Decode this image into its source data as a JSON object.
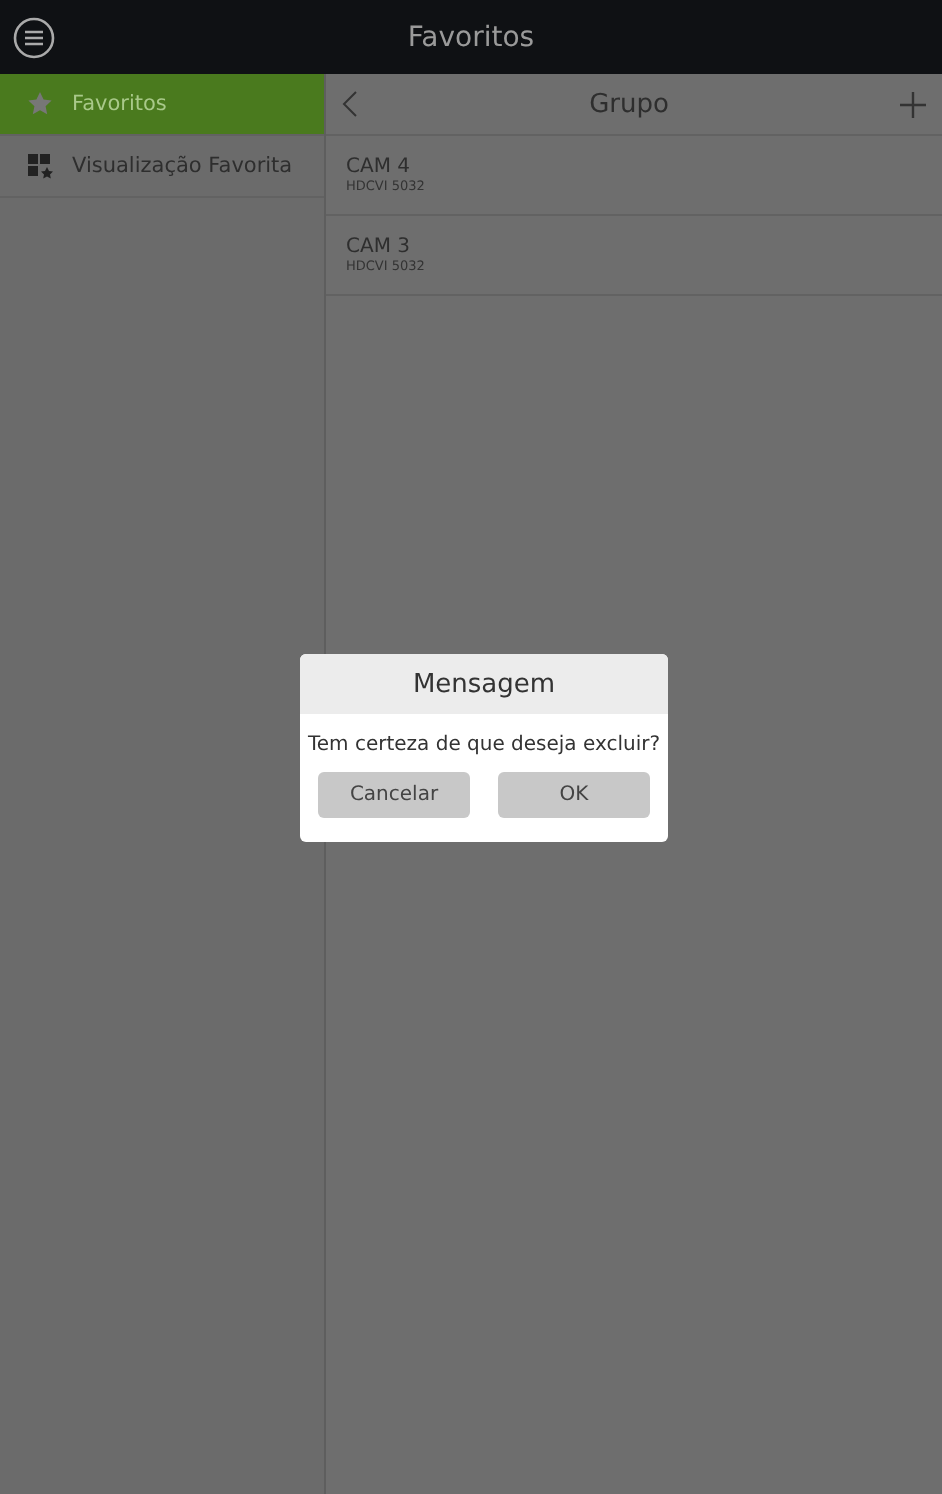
{
  "header": {
    "title": "Favoritos"
  },
  "sidebar": {
    "items": [
      {
        "label": "Favoritos",
        "kind": "favorites",
        "selected": true
      },
      {
        "label": "Visualização Favorita",
        "kind": "view",
        "selected": false
      }
    ]
  },
  "panel": {
    "title": "Grupo",
    "items": [
      {
        "name": "CAM 4",
        "model": "HDCVI 5032"
      },
      {
        "name": "CAM 3",
        "model": "HDCVI 5032"
      }
    ]
  },
  "dialog": {
    "title": "Mensagem",
    "message": "Tem certeza de que deseja excluir?",
    "buttons": [
      "Cancelar",
      "OK"
    ]
  }
}
